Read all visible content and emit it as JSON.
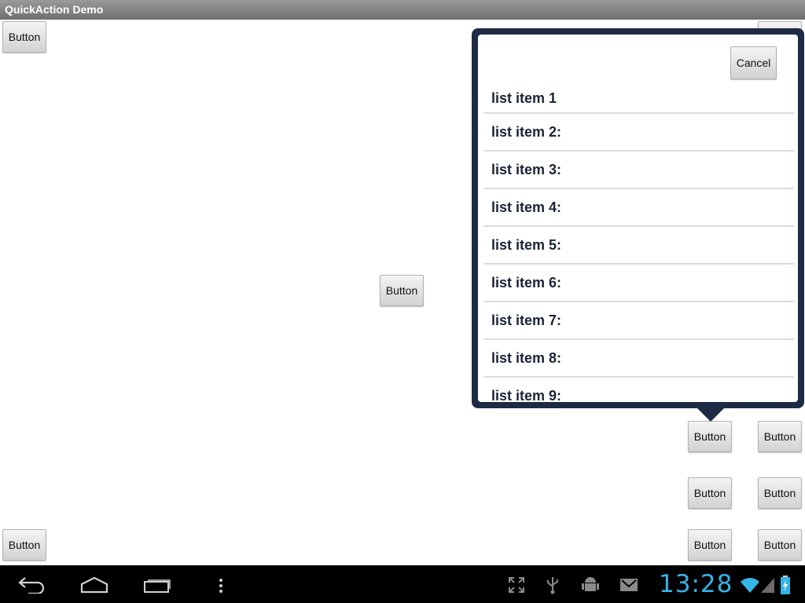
{
  "app": {
    "title": "QuickAction Demo"
  },
  "buttons": {
    "top_left": "Button",
    "top_right_partial": "Button",
    "center": "Button",
    "anchor": "Button",
    "right_row1": "Button",
    "mid_row2_left": "Button",
    "mid_row2_right": "Button",
    "bottom_left": "Button",
    "bottom_mid": "Button",
    "bottom_right": "Button"
  },
  "popup": {
    "cancel_label": "Cancel",
    "items": [
      "list item 1",
      "list item 2:",
      "list item 3:",
      "list item 4:",
      "list item 5:",
      "list item 6:",
      "list item 7:",
      "list item 8:",
      "list item 9:"
    ]
  },
  "status_bar": {
    "time": "13:28",
    "icons": [
      "fullscreen-icon",
      "usb-icon",
      "android-debug-icon",
      "gmail-icon",
      "wifi-icon",
      "signal-icon",
      "battery-charging-icon"
    ]
  },
  "nav_bar": {
    "icons": [
      "back-icon",
      "home-icon",
      "recent-apps-icon",
      "menu-icon"
    ]
  },
  "colors": {
    "popup_frame": "#1e2b45",
    "clock": "#33b5e5",
    "title_bar": "#7f7f7f"
  }
}
